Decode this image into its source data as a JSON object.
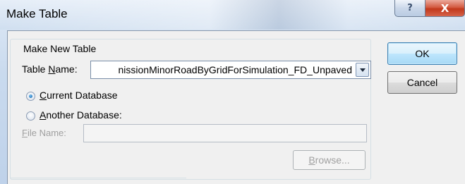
{
  "window": {
    "title": "Make Table",
    "help_glyph": "?",
    "close_glyph": "X"
  },
  "group": {
    "label": "Make New Table"
  },
  "table_name": {
    "label_pre": "Table ",
    "label_hot": "N",
    "label_post": "ame:",
    "value": "nissionMinorRoadByGridForSimulation_FD_Unpaved"
  },
  "options": {
    "current": {
      "hot": "C",
      "rest": "urrent Database",
      "selected": true
    },
    "another": {
      "hot": "A",
      "rest": "nother Database:",
      "selected": false
    }
  },
  "file_name": {
    "label_hot": "F",
    "label_rest": "ile Name:",
    "value": ""
  },
  "buttons": {
    "ok": "OK",
    "cancel": "Cancel",
    "browse_hot": "B",
    "browse_rest": "rowse..."
  },
  "colors": {
    "ok_border": "#3c7fb1",
    "close_red": "#c2381b",
    "radio_dot": "#1f6fb5"
  },
  "icons": {
    "help": "help-icon",
    "close": "close-icon",
    "dropdown": "chevron-down-icon"
  }
}
